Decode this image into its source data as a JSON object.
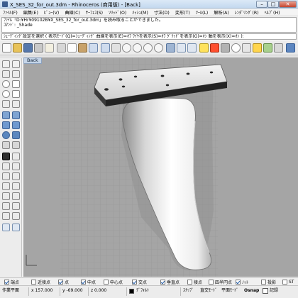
{
  "window": {
    "title": "X_SES_32_for_out.3dm - Rhinoceros (商用版) - [Back]",
    "minimize_glyph": "–",
    "maximize_glyph": "□",
    "close_glyph": "✕"
  },
  "menu": [
    "ﾌｧｲﾙ(F)",
    "編集(E)",
    "ﾋﾞｭｰ(V)",
    "曲線(C)",
    "ｻｰﾌｪｽ(S)",
    "ｿﾘｯﾄﾞ(O)",
    "ﾒｯｼｭ(M)",
    "寸法(D)",
    "変形(T)",
    "ﾂｰﾙ(L)",
    "解析(A)",
    "ﾚﾝﾀﾞﾘﾝｸﾞ(R)",
    "ﾍﾙﾌﾟ(H)"
  ],
  "command_history": [
    "ﾌｧｲﾙ「D:¥Hr¥09102B¥X_SES_32_for_out.3dm」を読み取ることができました。",
    "ｺﾏﾝﾄﾞ: _Shade"
  ],
  "command_prompt": "ｼｪｰﾃﾞｨﾝｸﾞ設定を選択 ( 表示ﾓｰﾄﾞ(Q)=ｼｪｰﾃﾞｨﾝｸﾞ 曲線を表示(E)=ｵﾌ ﾜｲﾔを表示(S)=ｵﾌ ｸﾞﾘｯﾄﾞを表示(G)=ｵﾝ 軸を表示(X)=ｵﾝ ):",
  "viewport": {
    "label": "Back",
    "background_color": "#a5a5a5",
    "grid_color": "#969696"
  },
  "osnap": [
    {
      "label": "端点",
      "checked": true
    },
    {
      "label": "近接点",
      "checked": false
    },
    {
      "label": "点",
      "checked": true
    },
    {
      "label": "中点",
      "checked": true
    },
    {
      "label": "中心点",
      "checked": false
    },
    {
      "label": "交点",
      "checked": true
    },
    {
      "label": "垂直点",
      "checked": true
    },
    {
      "label": "接点",
      "checked": false
    },
    {
      "label": "四半円点",
      "checked": false
    },
    {
      "label": "ﾉｯﾄ",
      "checked": true
    },
    {
      "label": "投影",
      "checked": false
    },
    {
      "label": "ST",
      "checked": false
    }
  ],
  "status": {
    "plane": "作業平面",
    "x": "x 157.000",
    "y": "y -69.000",
    "z": "z 0.000",
    "layer": "ﾃﾞﾌｫﾙﾄ",
    "snap": "ｽﾅｯﾌﾟ",
    "ortho": "直交ﾓｰﾄﾞ",
    "planar": "平面ﾓｰﾄﾞ",
    "osnap": "Osnap",
    "record": "記録"
  },
  "colors": {
    "layer_swatch": "#000000",
    "accent": "#3c6fb4"
  }
}
